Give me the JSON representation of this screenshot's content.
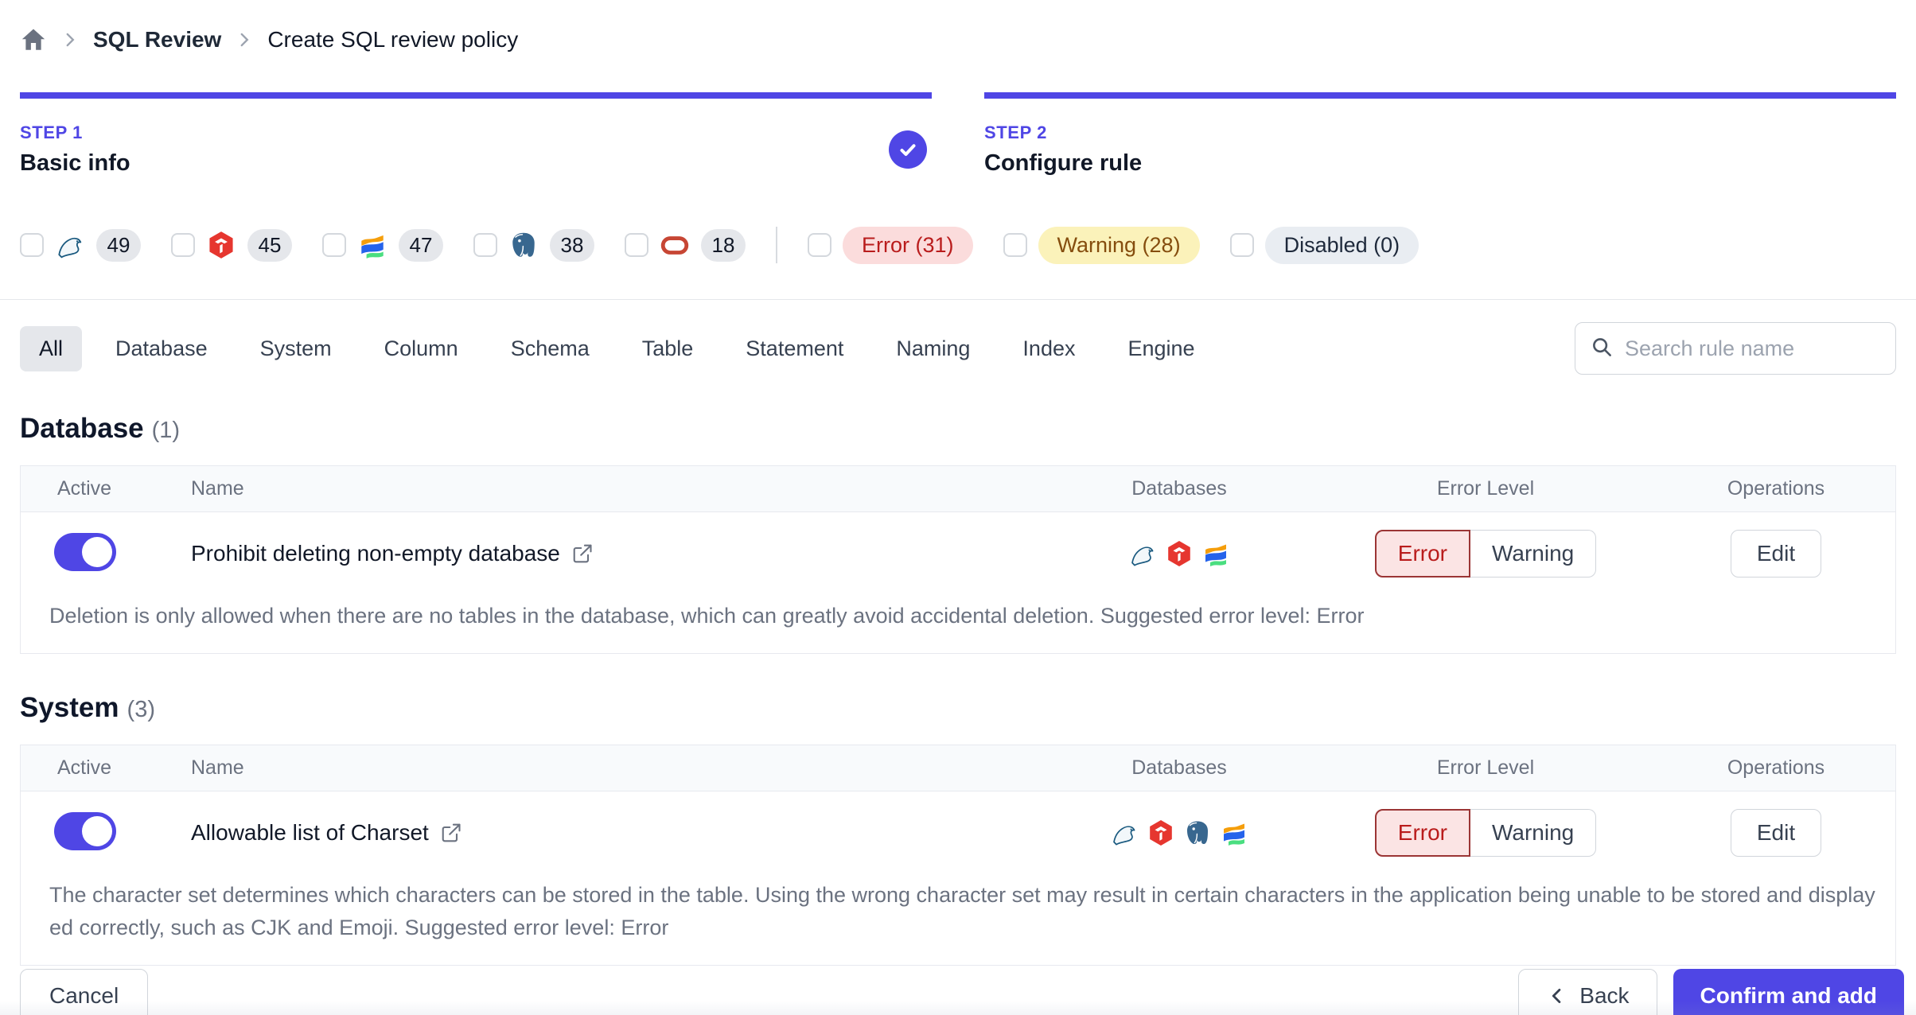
{
  "breadcrumb": {
    "items": [
      "SQL Review",
      "Create SQL review policy"
    ]
  },
  "steps": [
    {
      "label": "STEP 1",
      "title": "Basic info",
      "status": "completed"
    },
    {
      "label": "STEP 2",
      "title": "Configure rule",
      "status": "current"
    }
  ],
  "filters": {
    "engines": [
      {
        "name": "MySQL",
        "count": "49"
      },
      {
        "name": "TiDB",
        "count": "45"
      },
      {
        "name": "OceanBase",
        "count": "47"
      },
      {
        "name": "PostgreSQL",
        "count": "38"
      },
      {
        "name": "Oracle",
        "count": "18"
      }
    ],
    "levels": [
      {
        "label": "Error (31)"
      },
      {
        "label": "Warning (28)"
      },
      {
        "label": "Disabled (0)"
      }
    ]
  },
  "tabs": {
    "items": [
      "All",
      "Database",
      "System",
      "Column",
      "Schema",
      "Table",
      "Statement",
      "Naming",
      "Index",
      "Engine"
    ],
    "selected": "All"
  },
  "search": {
    "placeholder": "Search rule name"
  },
  "table_headers": {
    "active": "Active",
    "name": "Name",
    "databases": "Databases",
    "error_level": "Error Level",
    "operations": "Operations"
  },
  "error_levels": {
    "error": "Error",
    "warning": "Warning"
  },
  "operations": {
    "edit": "Edit"
  },
  "sections": [
    {
      "title": "Database",
      "count": "(1)",
      "rules": [
        {
          "name": "Prohibit deleting non-empty database",
          "engines": [
            "MySQL",
            "TiDB",
            "OceanBase"
          ],
          "selected_level": "Error",
          "active": true,
          "description": "Deletion is only allowed when there are no tables in the database, which can greatly avoid accidental deletion. Suggested error level: Error"
        }
      ]
    },
    {
      "title": "System",
      "count": "(3)",
      "rules": [
        {
          "name": "Allowable list of Charset",
          "engines": [
            "MySQL",
            "TiDB",
            "PostgreSQL",
            "OceanBase"
          ],
          "selected_level": "Error",
          "active": true,
          "description": "The character set determines which characters can be stored in the table. Using the wrong character set may result in certain characters in the application being unable to be stored and displayed correctly, such as CJK and Emoji. Suggested error level: Error"
        }
      ]
    }
  ],
  "footer": {
    "cancel": "Cancel",
    "back": "Back",
    "confirm": "Confirm and add"
  },
  "colors": {
    "accent": "#4f46e5",
    "error_text": "#b91c1c",
    "error_bg": "#fbdcdc",
    "warning_text": "#854d0e",
    "warning_bg": "#fbf2ba",
    "disabled_bg": "#e9edf2"
  }
}
